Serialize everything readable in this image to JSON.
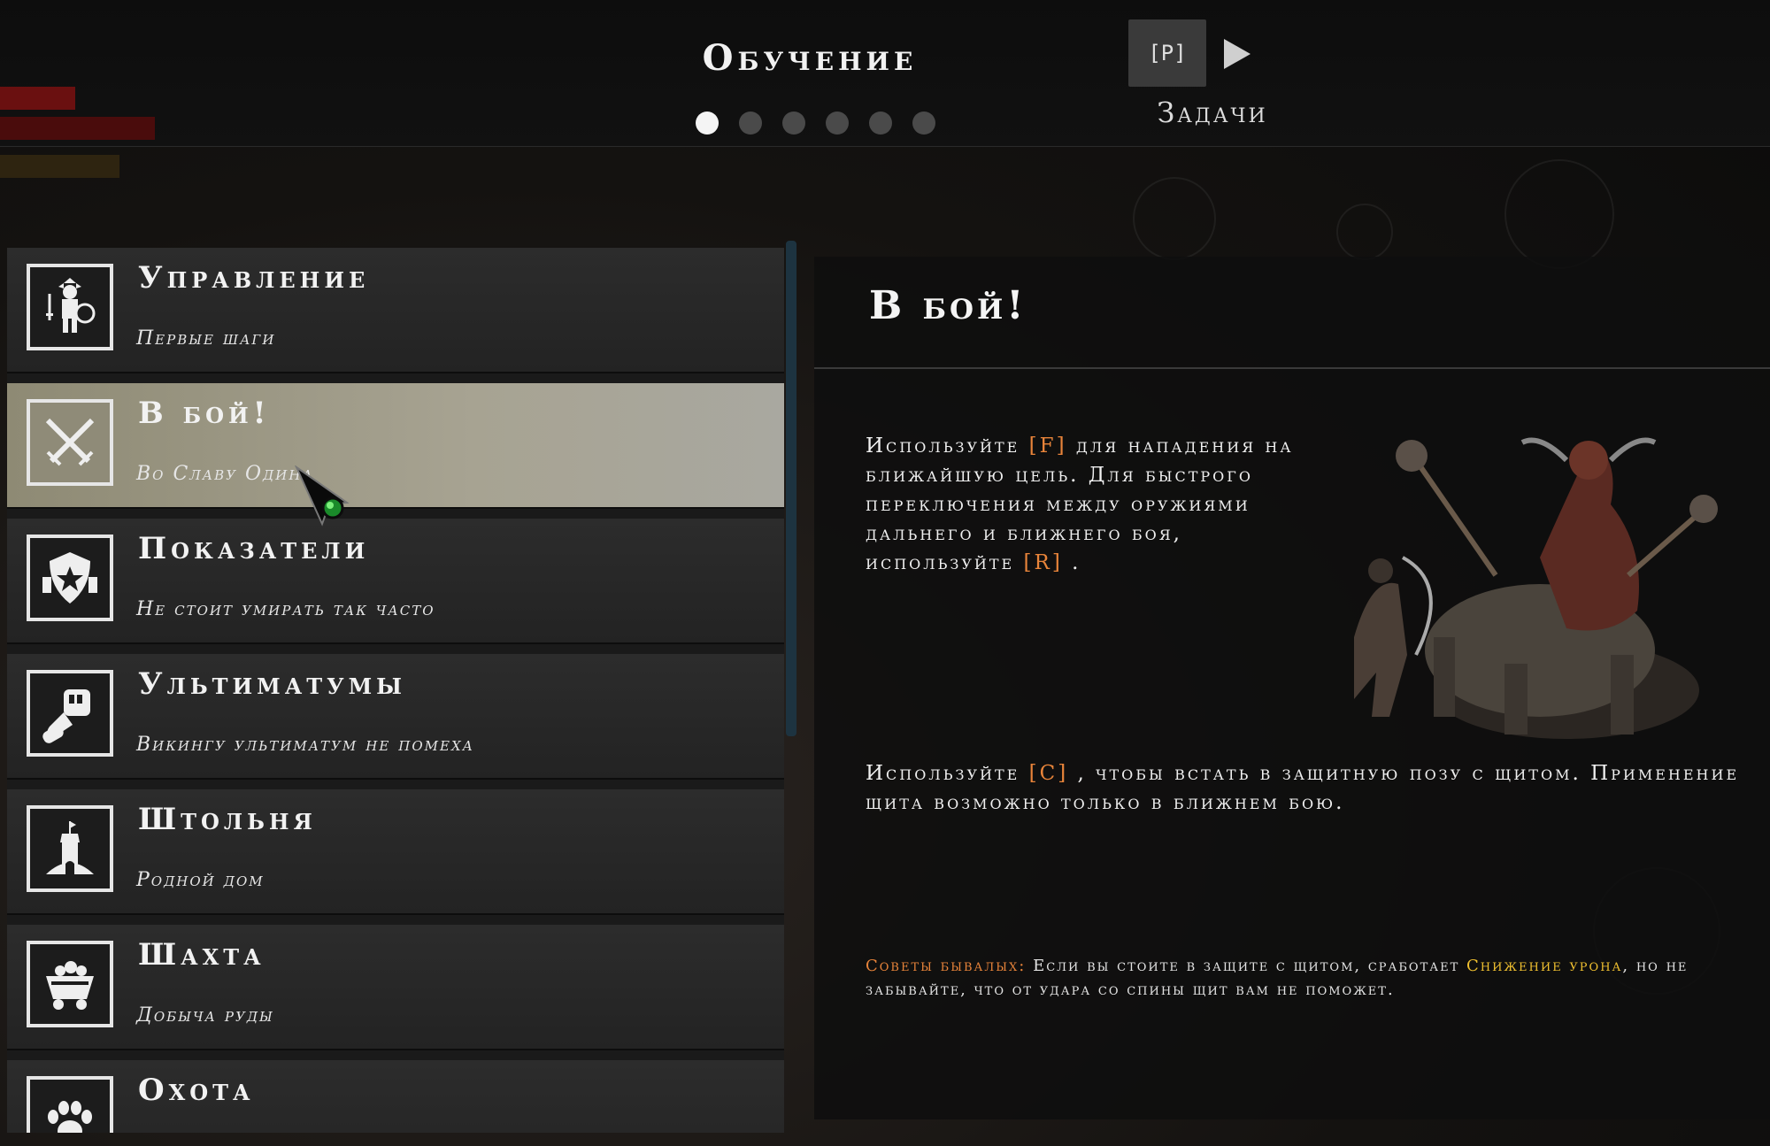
{
  "header": {
    "title": "Обучение",
    "pages_total": 6,
    "active_page": 1,
    "tasks_key": "[P]",
    "tasks_label": "Задачи"
  },
  "tutorial_list": [
    {
      "title": "Управление",
      "subtitle": "Первые шаги",
      "icon": "viking-warrior-icon",
      "selected": false
    },
    {
      "title": "В бой!",
      "subtitle": "Во Славу Одина",
      "icon": "crossed-swords-icon",
      "selected": true
    },
    {
      "title": "Показатели",
      "subtitle": "Не стоит умирать так часто",
      "icon": "shield-star-icon",
      "selected": false
    },
    {
      "title": "Ультиматумы",
      "subtitle": "Викингу ультиматум не помеха",
      "icon": "fist-scroll-icon",
      "selected": false
    },
    {
      "title": "Штольня",
      "subtitle": "Родной дом",
      "icon": "tower-icon",
      "selected": false
    },
    {
      "title": "Шахта",
      "subtitle": "Добыча руды",
      "icon": "mine-cart-icon",
      "selected": false
    },
    {
      "title": "Охота",
      "subtitle": "",
      "icon": "paw-icon",
      "selected": false
    }
  ],
  "detail": {
    "title": "В бой!",
    "para1": {
      "p1": "Используйте ",
      "key1": "[F]",
      "p2": "  для нападения на ближайшую цель.  Для быстрого переключения между оружиями дальнего и ближнего боя, используйте ",
      "key2": "[R]",
      "p3": " ."
    },
    "para2": {
      "p1": "Используйте ",
      "key1": "[C]",
      "p2": " , чтобы встать в защитную позу с щитом. Применение щита возможно только в ближнем бою."
    },
    "tip": {
      "label": "Советы бывалых:",
      "p1": " Если вы стоите в защите с щитом, сработает ",
      "highlight": "Снижение урона",
      "p2": ", но не забывайте, что от удара со спины щит вам не поможет."
    }
  },
  "colors": {
    "key_accent": "#e8843a",
    "highlight": "#f0c030",
    "selected_row": "#a7a392"
  }
}
